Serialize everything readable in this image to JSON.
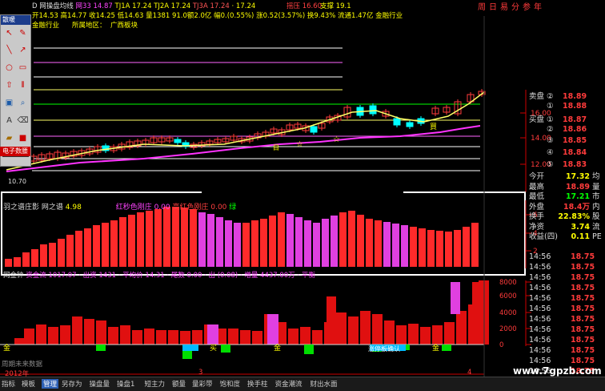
{
  "header": {
    "title_prefix": "D 网操盘均线",
    "ind_labels": [
      {
        "text": "网33 14.87",
        "color": "#ff44ff"
      },
      {
        "text": "TJ1A 17.24",
        "color": "#ffff00"
      },
      {
        "text": "TJ2A 17.24",
        "color": "#ffff00"
      },
      {
        "text": "TJ3A 17.24",
        "color": "#ff5555"
      },
      {
        "text": "· 17.24",
        "color": "#ffff00"
      }
    ],
    "pressure_label": "摇压 16.60",
    "support_label": "支撑 19.1",
    "line2": "开14.53 高14.77 收14.25 低14.63 量1381 91.0额2.0亿 幅0.(0.55%) 涨0.52(3.57%) 换9.43% 流通1.47亿 金融行业",
    "industry_tag": "金融行业",
    "region_label": "所属地区：",
    "region_value": "广西板块"
  },
  "drawing_toolbar": {
    "title": "散暖",
    "clock_label": "电子数腰"
  },
  "menu_row": [
    "周",
    "日",
    "易",
    "分",
    "参",
    "年"
  ],
  "price_axis_labels": [
    "16.00",
    "14.00",
    "12.00",
    "10.70"
  ],
  "main_low_label": "10.70",
  "ind1": {
    "name": "羽之谱庄影",
    "sub": "网之谱",
    "value": "4.98",
    "legend": [
      {
        "text": "红秒色刚庄",
        "color": "#ff44ff"
      },
      {
        "text": "0.00",
        "color": "#ff44ff"
      },
      {
        "text": "高红色刚庄",
        "color": "#ff4040"
      },
      {
        "text": "0.00",
        "color": "#ff4040"
      },
      {
        "text": "绿",
        "color": "#00ff00"
      }
    ],
    "axis": [
      "6",
      "4",
      "2"
    ]
  },
  "ind2": {
    "label": "网金钟",
    "status_text": "资金流·1017.07 · 出资 1431 · 平均价 14.31 · 尾数 0.00 · 出 (0.08) · 增量 4437.00万 · 平衡",
    "axis": [
      "8000",
      "6000",
      "4000",
      "2000",
      "0"
    ],
    "marks": [
      "金",
      "买",
      "金",
      "金"
    ],
    "buy_tag": "涨停板确认"
  },
  "quote_panel": {
    "rows": [
      {
        "label": "卖盘",
        "value": "18.89",
        "sub": "②",
        "color": "#ff3b3b"
      },
      {
        "label": "",
        "value": "18.88",
        "sub": "①",
        "color": "#ff3b3b"
      },
      {
        "label": "买盘",
        "value": "18.87",
        "sub": "①",
        "color": "#ff3b3b"
      },
      {
        "label": "",
        "value": "18.86",
        "sub": "②",
        "color": "#ff3b3b"
      },
      {
        "label": "",
        "value": "18.85",
        "sub": "③",
        "color": "#ff3b3b"
      },
      {
        "label": "",
        "value": "18.84",
        "sub": "④",
        "color": "#ff3b3b"
      },
      {
        "label": "",
        "value": "18.83",
        "sub": "⑤",
        "color": "#ff3b3b"
      }
    ],
    "stats": [
      {
        "label": "今开",
        "value": "17.32",
        "tail": "均",
        "color": "#ffff00"
      },
      {
        "label": "最高",
        "value": "18.89",
        "tail": "量",
        "color": "#ff3b3b"
      },
      {
        "label": "最低",
        "value": "17.21",
        "tail": "市",
        "color": "#00ff00"
      },
      {
        "label": "外盘",
        "value": "18.4万",
        "tail": "内",
        "color": "#ff3b3b"
      },
      {
        "label": "换手",
        "value": "22.83%",
        "tail": "股",
        "color": "#ffff00"
      },
      {
        "label": "净资",
        "value": "3.74",
        "tail": "流",
        "color": "#ffff00"
      },
      {
        "label": "收益(四)",
        "value": "0.11",
        "tail": "PE",
        "color": "#ffff00"
      }
    ],
    "ticks": [
      {
        "time": "14:56",
        "price": "18.75"
      },
      {
        "time": "14:56",
        "price": "18.75"
      },
      {
        "time": "14:56",
        "price": "18.75"
      },
      {
        "time": "14:56",
        "price": "18.75"
      },
      {
        "time": "14:56",
        "price": "18.75"
      },
      {
        "time": "14:56",
        "price": "18.75"
      },
      {
        "time": "14:56",
        "price": "18.75"
      },
      {
        "time": "14:56",
        "price": "18.75"
      },
      {
        "time": "14:56",
        "price": "18.75"
      },
      {
        "time": "14:56",
        "price": "18.75"
      },
      {
        "time": "14:56",
        "price": "18.75"
      },
      {
        "time": "14:56",
        "price": "18.75"
      },
      {
        "time": "14:56",
        "price": "18.75"
      }
    ]
  },
  "status_footer": {
    "left": "周期未来数据",
    "date": "2012年",
    "mark3": "3",
    "mark4": "4"
  },
  "bottom_tabs": [
    {
      "label": "指标",
      "active": false
    },
    {
      "label": "模板",
      "active": false
    },
    {
      "label": "管理",
      "active": true
    },
    {
      "label": "另存为",
      "active": false
    },
    {
      "label": "操盘量",
      "active": false
    },
    {
      "label": "操盘1",
      "active": false
    },
    {
      "label": "短主力",
      "active": false
    },
    {
      "label": "额量",
      "active": false
    },
    {
      "label": "量彩带",
      "active": false
    },
    {
      "label": "饱和度",
      "active": false
    },
    {
      "label": "换手柱",
      "active": false
    },
    {
      "label": "资金潮流",
      "active": false
    },
    {
      "label": "财出水面",
      "active": false
    }
  ],
  "watermark": "www.7gpzb.com",
  "colors": {
    "up": "#ff3b3b",
    "down": "#00ffff",
    "ma_yellow": "#ffff66",
    "ma_magenta": "#ff33ff",
    "grid": "#888"
  }
}
